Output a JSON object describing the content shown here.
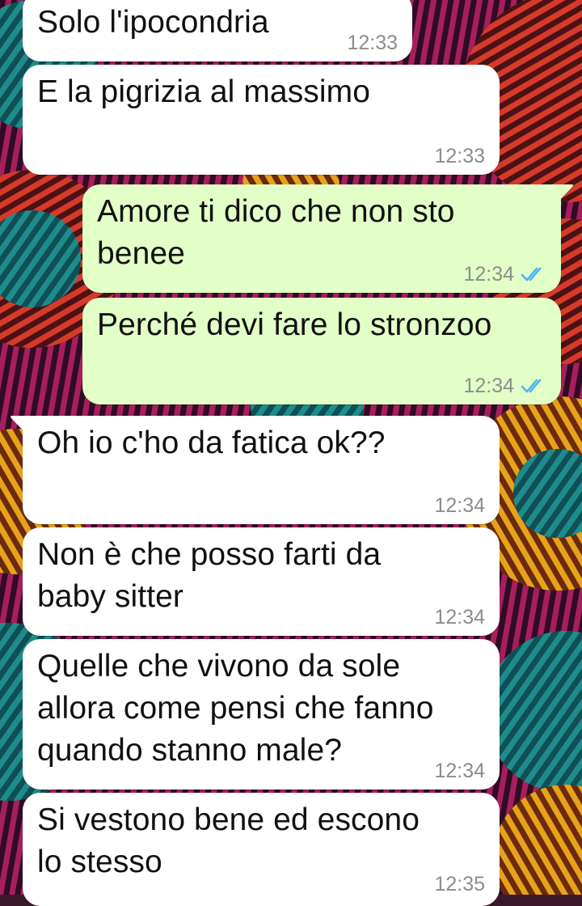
{
  "colors": {
    "incoming_bubble": "#ffffff",
    "outgoing_bubble": "#e2ffc8",
    "timestamp": "#8d8d8d",
    "read_ticks": "#4fb6ec"
  },
  "messages": [
    {
      "direction": "in",
      "text": "Solo l'ipocondria",
      "time": "12:33"
    },
    {
      "direction": "in",
      "text": "E la pigrizia al massimo",
      "time": "12:33"
    },
    {
      "direction": "out",
      "text": "Amore ti dico che non sto\nbenee",
      "time": "12:34",
      "status_icon": "double-check-read-icon"
    },
    {
      "direction": "out",
      "text": "Perché devi fare lo stronzoo",
      "time": "12:34",
      "status_icon": "double-check-read-icon"
    },
    {
      "direction": "in",
      "text": "Oh io c'ho da fatica ok??",
      "time": "12:34"
    },
    {
      "direction": "in",
      "text": "Non è che posso farti da\nbaby sitter",
      "time": "12:34"
    },
    {
      "direction": "in",
      "text": "Quelle che vivono da sole\nallora come pensi che fanno\nquando stanno male?",
      "time": "12:34"
    },
    {
      "direction": "in",
      "text": "Si vestono bene ed escono\nlo stesso",
      "time": "12:35"
    }
  ]
}
